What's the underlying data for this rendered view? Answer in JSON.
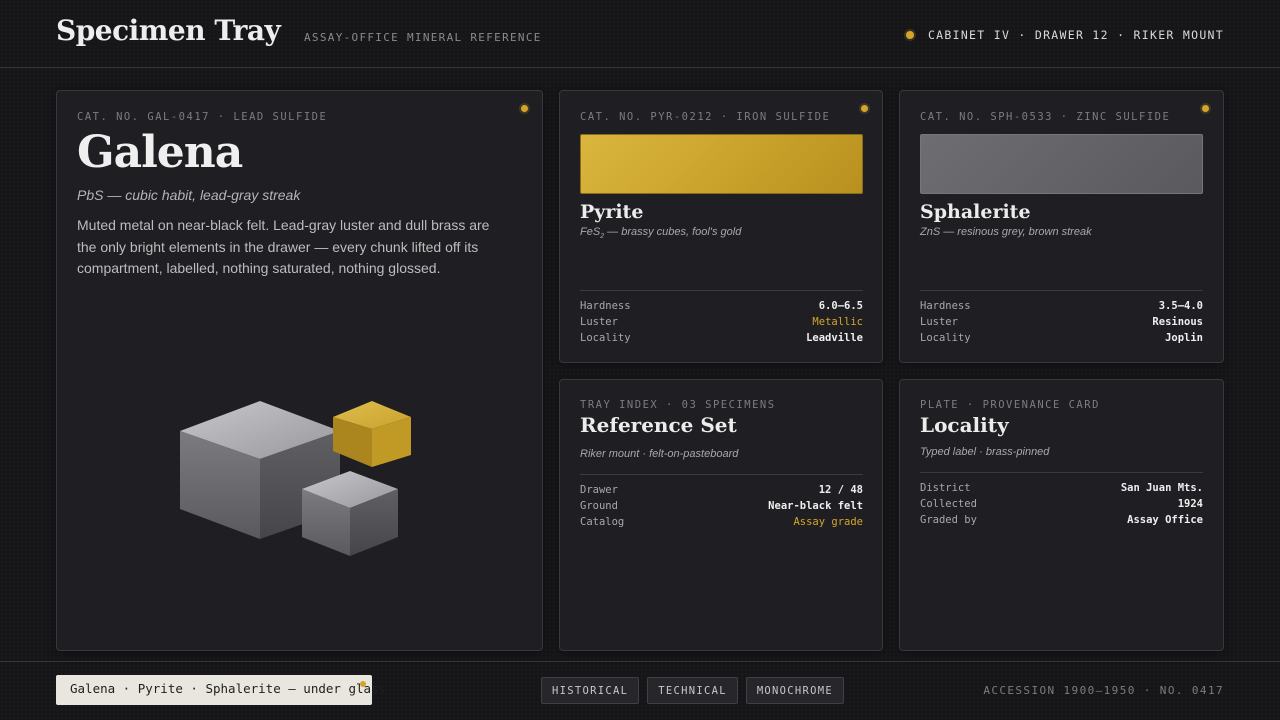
{
  "header": {
    "title": "Specimen Tray",
    "subtitle": "ASSAY-OFFICE MINERAL REFERENCE",
    "location": "CABINET IV · DRAWER 12 · RIKER MOUNT"
  },
  "colors": {
    "accent": "#d4a52a",
    "background": "#161619",
    "card": "#1f1f23",
    "pyrite_swatch": "#d1ac36",
    "sphalerite_swatch": "#656569"
  },
  "galena": {
    "catalog": "CAT. NO. GAL-0417 · LEAD SULFIDE",
    "name": "Galena",
    "formula": "PbS — cubic habit, lead-gray streak",
    "description": "Muted metal on near-black felt. Lead-gray luster and dull brass are the only bright elements in the drawer — every chunk lifted off its compartment, labelled, nothing saturated, nothing glossed."
  },
  "pyrite": {
    "catalog": "CAT. NO. PYR-0212 · IRON SULFIDE",
    "name": "Pyrite",
    "formula_base": "FeS",
    "formula_sub": "2",
    "formula_rest": " — brassy cubes, fool's gold",
    "props": [
      {
        "key": "Hardness",
        "value": "6.0–6.5"
      },
      {
        "key": "Luster",
        "value": "Metallic"
      },
      {
        "key": "Locality",
        "value": "Leadville"
      }
    ]
  },
  "sphalerite": {
    "catalog": "CAT. NO. SPH-0533 · ZINC SULFIDE",
    "name": "Sphalerite",
    "formula": "ZnS — resinous grey, brown streak",
    "props": [
      {
        "key": "Hardness",
        "value": "3.5–4.0"
      },
      {
        "key": "Luster",
        "value": "Resinous"
      },
      {
        "key": "Locality",
        "value": "Joplin"
      }
    ]
  },
  "reference": {
    "catalog": "TRAY INDEX · 03 SPECIMENS",
    "title": "Reference Set",
    "subtitle": "Riker mount · felt-on-pasteboard",
    "props": [
      {
        "key": "Drawer",
        "value": "12 / 48"
      },
      {
        "key": "Ground",
        "value": "Near-black felt"
      },
      {
        "key": "Catalog",
        "value": "Assay grade"
      }
    ]
  },
  "locality": {
    "catalog": "PLATE · PROVENANCE CARD",
    "title": "Locality",
    "subtitle": "Typed label · brass-pinned",
    "props": [
      {
        "key": "District",
        "value": "San Juan Mts."
      },
      {
        "key": "Collected",
        "value": "1924"
      },
      {
        "key": "Graded by",
        "value": "Assay Office"
      }
    ]
  },
  "footer": {
    "label": "Galena · Pyrite · Sphalerite — under glass",
    "modes": [
      "HISTORICAL",
      "TECHNICAL",
      "MONOCHROME"
    ],
    "accession": "ACCESSION 1900–1950 · NO. 0417"
  }
}
